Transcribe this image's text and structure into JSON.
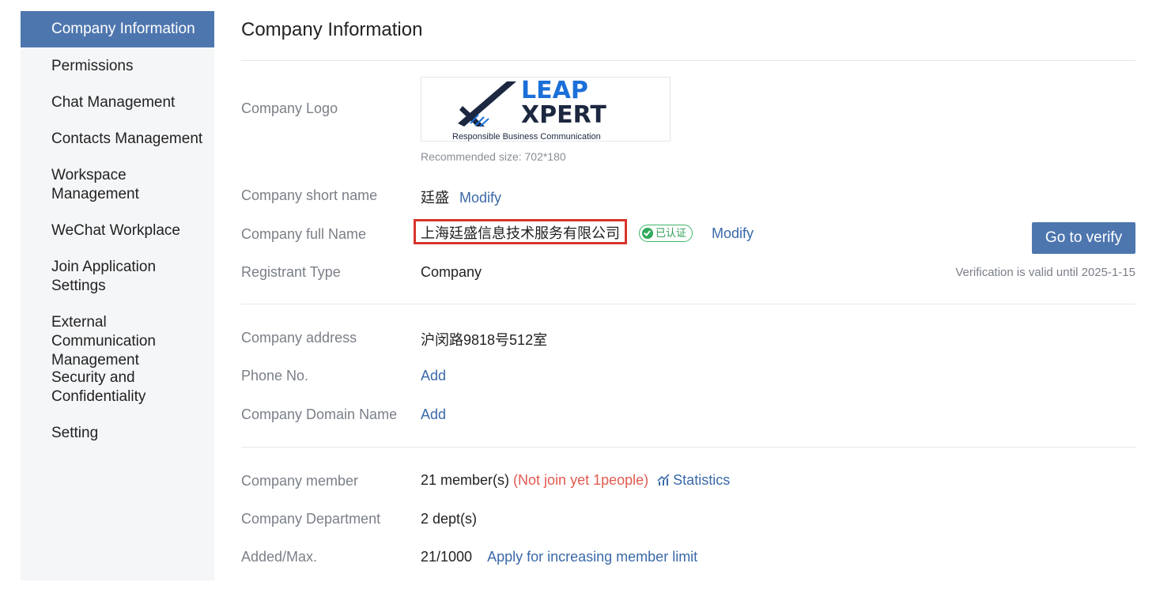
{
  "sidebar": {
    "items": [
      {
        "label": "Company Information"
      },
      {
        "label": "Permissions"
      },
      {
        "label": "Chat Management"
      },
      {
        "label": "Contacts Management"
      },
      {
        "label": "Workspace Management"
      },
      {
        "label": "WeChat Workplace"
      },
      {
        "label": "Join Application Settings"
      },
      {
        "label": "External Communication Management"
      },
      {
        "label": "Security and Confidentiality"
      },
      {
        "label": "Setting"
      }
    ]
  },
  "main": {
    "title": "Company Information",
    "logo": {
      "label": "Company Logo",
      "logo_word1": "LEAP",
      "logo_word2": "XPERT",
      "logo_tagline": "Responsible Business Communication",
      "hint": "Recommended size: 702*180",
      "brand_blue": "#1b6fd8",
      "brand_navy": "#1c2740"
    },
    "short_name": {
      "label": "Company short name",
      "value": "廷盛",
      "action": "Modify"
    },
    "full_name": {
      "label": "Company full Name",
      "value": "上海廷盛信息技术服务有限公司",
      "badge": "已认证",
      "action": "Modify"
    },
    "verify_button": "Go to verify",
    "registrant": {
      "label": "Registrant Type",
      "value": "Company"
    },
    "validity": "Verification is valid until 2025-1-15",
    "address": {
      "label": "Company address",
      "value": "沪闵路9818号512室"
    },
    "phone": {
      "label": "Phone No.",
      "action": "Add"
    },
    "domain": {
      "label": "Company Domain Name",
      "action": "Add"
    },
    "member": {
      "label": "Company member",
      "value": "21 member(s)",
      "pending": "(Not join yet 1people)",
      "stats_link": "Statistics"
    },
    "department": {
      "label": "Company Department",
      "value": "2 dept(s)"
    },
    "added_max": {
      "label": "Added/Max.",
      "value": "21/1000",
      "action": "Apply for increasing member limit"
    }
  },
  "colors": {
    "accent": "#4e76ae",
    "link": "#3a69a8",
    "warning": "#e05a50",
    "verified": "#2faa5a",
    "highlight_border": "#d9342b"
  }
}
